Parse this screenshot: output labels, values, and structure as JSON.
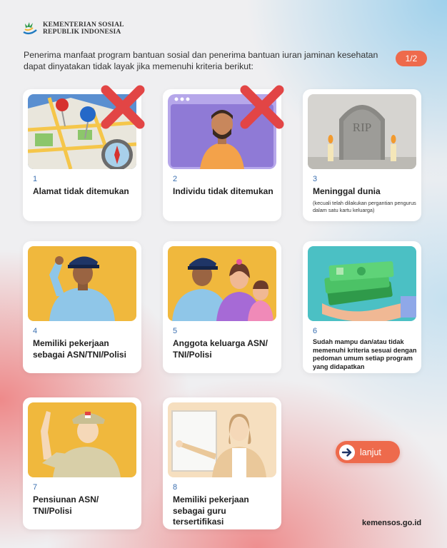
{
  "header": {
    "logo_line1": "KEMENTERIAN SOSIAL",
    "logo_line2": "REPUBLIK INDONESIA",
    "intro": "Penerima manfaat program bantuan sosial dan penerima bantuan iuran jaminan kesehatan dapat dinyatakan tidak layak jika memenuhi kriteria berikut:",
    "page_indicator": "1/2"
  },
  "cards": [
    {
      "num": "1",
      "title": "Alamat tidak ditemukan"
    },
    {
      "num": "2",
      "title": "Individu tidak ditemukan"
    },
    {
      "num": "3",
      "title": "Meninggal dunia",
      "note": "(kecuali telah dilakukan pergantian pengurus dalam satu kartu keluarga)",
      "img_text": "RIP"
    },
    {
      "num": "4",
      "title": "Memiliki pekerjaan sebagai ASN/TNI/Polisi"
    },
    {
      "num": "5",
      "title": "Anggota keluarga ASN/ TNI/Polisi"
    },
    {
      "num": "6",
      "title": "Sudah mampu dan/atau tidak memenuhi kriteria sesuai dengan pedoman umum setiap program yang didapatkan"
    },
    {
      "num": "7",
      "title": "Pensiunan ASN/ TNI/Polisi"
    },
    {
      "num": "8",
      "title": "Memiliki pekerjaan sebagai guru tersertifikasi"
    }
  ],
  "next_button": {
    "label": "lanjut",
    "icon": "arrow-right-icon"
  },
  "footer": {
    "site": "kemensos.go.id"
  },
  "colors": {
    "accent": "#ee6a4c",
    "number": "#3a6fb0"
  }
}
